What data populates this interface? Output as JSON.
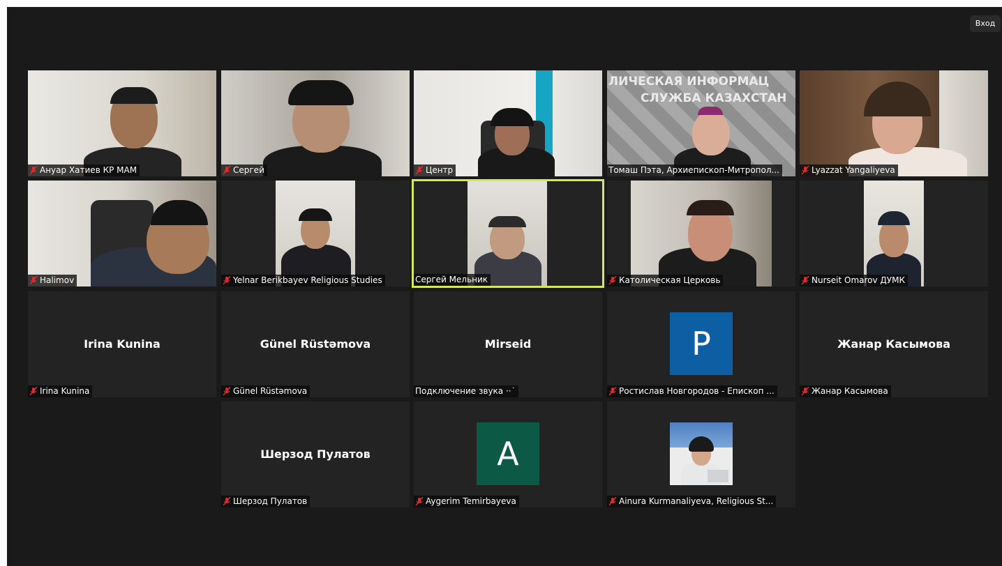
{
  "header": {
    "enter_label": "Вход"
  },
  "participants": [
    {
      "name": "Ануар Хатиев КР МАМ",
      "muted": true
    },
    {
      "name": "Сергей",
      "muted": true
    },
    {
      "name": "Центр",
      "muted": true
    },
    {
      "name": "Томаш Пэта, Архиепископ-Митропол...",
      "muted": false
    },
    {
      "name": "Lyazzat Yangaliyeva",
      "muted": true
    },
    {
      "name": "Halimov",
      "muted": true
    },
    {
      "name": "Yelnar Berikbayev Religious Studies",
      "muted": true
    },
    {
      "name": "Сергей Мельник",
      "muted": false,
      "active_speaker": true
    },
    {
      "name": "Католическая Церковь",
      "muted": true
    },
    {
      "name": "Nurseit Omarov ДУМК",
      "muted": true
    },
    {
      "name": "Irina Kunina",
      "display": "Irina Kunina",
      "muted": true
    },
    {
      "name": "Günel Rüstəmova",
      "display": "Günel Rüstəmova",
      "muted": true
    },
    {
      "name": "Подключение звука ··˙",
      "display": "Mirseid",
      "muted": false
    },
    {
      "name": "Ростислав Новгородов - Епископ ...",
      "avatar_letter": "P",
      "avatar_color": "#0e5ea3",
      "muted": true
    },
    {
      "name": "Жанар Касымова",
      "display": "Жанар Касымова",
      "muted": true
    },
    {
      "name": "Шерзод Пулатов",
      "display": "Шерзод Пулатов",
      "muted": true
    },
    {
      "name": "Aygerim Temirbayeva",
      "avatar_letter": "A",
      "avatar_color": "#0c5a45",
      "muted": true
    },
    {
      "name": "Ainura Kurmanaliyeva, Religious St...",
      "muted": true
    }
  ],
  "scene_text": {
    "banner_line1": "ЛИЧЕСКАЯ ИНФОРМАЦ",
    "banner_line2": "СЛУЖБА КАЗАХСТАН"
  },
  "colors": {
    "background": "#1a1a1a",
    "tile": "#232323",
    "active_speaker_border": "#d5e85d",
    "mute_icon": "#e02b2b"
  },
  "icons": {
    "mute": "microphone-muted-icon"
  }
}
